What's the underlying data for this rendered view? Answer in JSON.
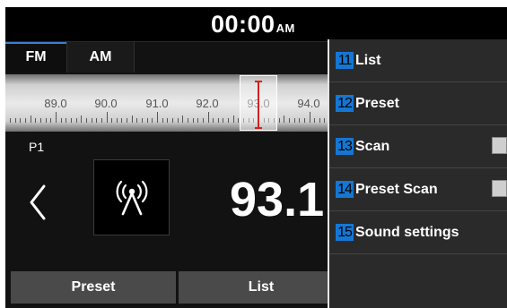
{
  "status": {
    "time": "00:00",
    "ampm": "AM"
  },
  "tabs": [
    {
      "label": "FM",
      "active": true
    },
    {
      "label": "AM",
      "active": false
    }
  ],
  "tuner": {
    "frequency_labels": [
      "89.0",
      "90.0",
      "91.0",
      "92.0",
      "93.0",
      "94.0"
    ],
    "frequency_display": "93.1",
    "preset_label": "P1"
  },
  "bottom_buttons": {
    "preset": "Preset",
    "list": "List"
  },
  "menu": {
    "items": [
      {
        "number": "11",
        "label": "List",
        "checkbox": false
      },
      {
        "number": "12",
        "label": "Preset",
        "checkbox": false
      },
      {
        "number": "13",
        "label": "Scan",
        "checkbox": true,
        "checked": false
      },
      {
        "number": "14",
        "label": "Preset Scan",
        "checkbox": true,
        "checked": false
      },
      {
        "number": "15",
        "label": "Sound settings",
        "checkbox": false
      }
    ]
  },
  "icons": {
    "back": "chevron-left-icon",
    "antenna": "radio-antenna-icon"
  },
  "colors": {
    "accent": "#1477d4",
    "needle": "#d42121",
    "tab_indicator": "#3d7bd6"
  }
}
